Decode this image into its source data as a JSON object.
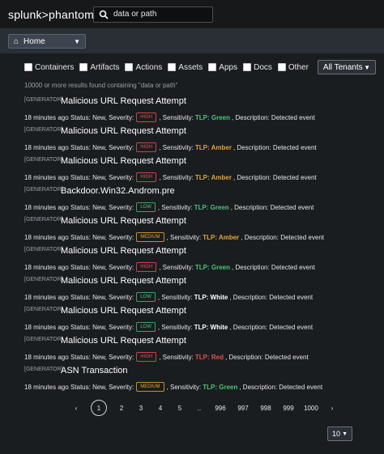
{
  "header": {
    "logo": "splunk>phantom"
  },
  "search": {
    "value": "data or path"
  },
  "nav": {
    "home_label": "Home"
  },
  "filters": {
    "items": [
      "Containers",
      "Artifacts",
      "Actions",
      "Assets",
      "Apps",
      "Docs",
      "Other"
    ],
    "tenant": "All Tenants"
  },
  "results_count": "10000 or more results found containing \"data or path\"",
  "results": [
    {
      "tag": "[GENERATOR]",
      "title": "Malicious URL Request Attempt",
      "time": "18 minutes ago",
      "status_text": "Status: New, Severity:",
      "severity": "HIGH",
      "sensitivity_label": ", Sensitivity:",
      "tlp": "TLP: Green",
      "tlp_color": "#4ec27a",
      "description": ", Description: Detected event"
    },
    {
      "tag": "[GENERATOR]",
      "title": "Malicious URL Request Attempt",
      "time": "18 minutes ago",
      "status_text": "Status: New, Severity:",
      "severity": "HIGH",
      "sensitivity_label": ", Sensitivity:",
      "tlp": "TLP: Amber",
      "tlp_color": "#e0a637",
      "description": ", Description: Detected event"
    },
    {
      "tag": "[GENERATOR]",
      "title": "Malicious URL Request Attempt",
      "time": "18 minutes ago",
      "status_text": "Status: New, Severity:",
      "severity": "HIGH",
      "sensitivity_label": ", Sensitivity:",
      "tlp": "TLP: Amber",
      "tlp_color": "#e0a637",
      "description": ", Description: Detected event"
    },
    {
      "tag": "[GENERATOR]",
      "title": "Backdoor.Win32.Androm.pre",
      "time": "18 minutes ago",
      "status_text": "Status: New, Severity:",
      "severity": "LOW",
      "sensitivity_label": ", Sensitivity:",
      "tlp": "TLP: Green",
      "tlp_color": "#4ec27a",
      "description": ", Description: Detected event"
    },
    {
      "tag": "[GENERATOR]",
      "title": "Malicious URL Request Attempt",
      "time": "18 minutes ago",
      "status_text": "Status: New, Severity:",
      "severity": "MEDIUM",
      "sensitivity_label": ", Sensitivity:",
      "tlp": "TLP: Amber",
      "tlp_color": "#e0a637",
      "description": ", Description: Detected event"
    },
    {
      "tag": "[GENERATOR]",
      "title": "Malicious URL Request Attempt",
      "time": "18 minutes ago",
      "status_text": "Status: New, Severity:",
      "severity": "HIGH",
      "sensitivity_label": ", Sensitivity:",
      "tlp": "TLP: Green",
      "tlp_color": "#4ec27a",
      "description": ", Description: Detected event"
    },
    {
      "tag": "[GENERATOR]",
      "title": "Malicious URL Request Attempt",
      "time": "18 minutes ago",
      "status_text": "Status: New, Severity:",
      "severity": "LOW",
      "sensitivity_label": ", Sensitivity:",
      "tlp": "TLP: White",
      "tlp_color": "#ffffff",
      "description": ", Description: Detected event"
    },
    {
      "tag": "[GENERATOR]",
      "title": "Malicious URL Request Attempt",
      "time": "18 minutes ago",
      "status_text": "Status: New, Severity:",
      "severity": "LOW",
      "sensitivity_label": ", Sensitivity:",
      "tlp": "TLP: White",
      "tlp_color": "#ffffff",
      "description": ", Description: Detected event"
    },
    {
      "tag": "[GENERATOR]",
      "title": "Malicious URL Request Attempt",
      "time": "18 minutes ago",
      "status_text": "Status: New, Severity:",
      "severity": "HIGH",
      "sensitivity_label": ", Sensitivity:",
      "tlp": "TLP: Red",
      "tlp_color": "#e35252",
      "description": ", Description: Detected event"
    },
    {
      "tag": "[GENERATOR]",
      "title": "ASN Transaction",
      "time": "18 minutes ago",
      "status_text": "Status: New, Severity:",
      "severity": "MEDIUM",
      "sensitivity_label": ", Sensitivity:",
      "tlp": "TLP: Green",
      "tlp_color": "#4ec27a",
      "description": ", Description: Detected event"
    }
  ],
  "pagination": {
    "prev": "‹",
    "pages": [
      "1",
      "2",
      "3",
      "4",
      "5",
      "..",
      "996",
      "997",
      "998",
      "999",
      "1000"
    ],
    "active": "1",
    "next": "›"
  },
  "per_page": {
    "value": "10"
  },
  "icons": {
    "search": "search-icon",
    "home": "home-icon",
    "chevron": "chevron-down-icon"
  }
}
